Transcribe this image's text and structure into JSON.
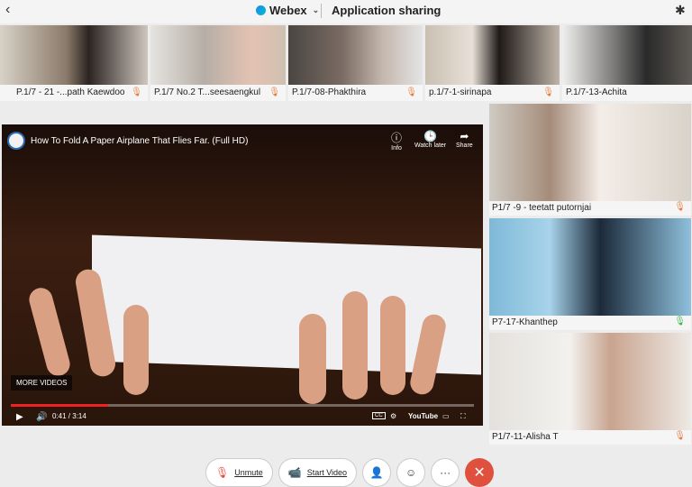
{
  "header": {
    "back_glyph": "‹",
    "app_name": "Webex",
    "chevron": "⌄",
    "mode": "Application sharing",
    "bluetooth_glyph": "✱"
  },
  "participants_strip": [
    {
      "name": "P.1/7 - 21 -...path Kaewdoo",
      "muted": true
    },
    {
      "name": "P.1/7 No.2 T...seesaengkul",
      "muted": true
    },
    {
      "name": "P.1/7-08-Phakthira",
      "muted": true
    },
    {
      "name": "p.1/7-1-sirinapa",
      "muted": true
    },
    {
      "name": "P.1/7-13-Achita",
      "muted": true
    }
  ],
  "video": {
    "title": "How To Fold A Paper Airplane That Flies Far. (Full HD)",
    "info_label": "Info",
    "watch_later_label": "Watch later",
    "share_label": "Share",
    "more_videos": "MORE VIDEOS",
    "time": "0:41 / 3:14",
    "progress_fraction": 0.21,
    "youtube_label": "YouTube",
    "cc_label": "CC"
  },
  "side_participants": [
    {
      "name": "P1/7 -9 - teetatt putornjai",
      "mic": "muted"
    },
    {
      "name": "P7-17-Khanthep",
      "mic": "active"
    },
    {
      "name": "P1/7-11-Alisha T",
      "mic": "muted"
    }
  ],
  "controls": {
    "unmute_label": "Unmute",
    "start_video_label": "Start Video",
    "participants_glyph": "👤",
    "reactions_glyph": "☺",
    "more_glyph": "···",
    "end_glyph": "✕"
  },
  "colors": {
    "muted_mic": "#e57a3c",
    "active_mic": "#3bb54a",
    "end_call": "#e0503e"
  }
}
